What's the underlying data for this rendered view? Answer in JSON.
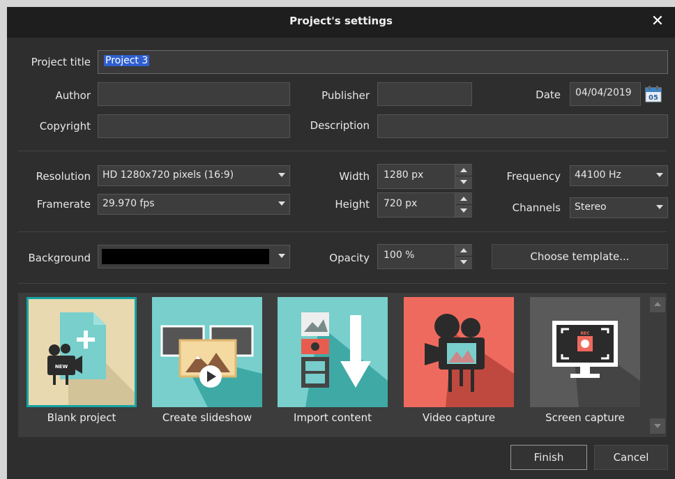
{
  "dialog": {
    "title": "Project's settings",
    "close_glyph": "✕"
  },
  "fields": {
    "project_title_label": "Project title",
    "project_title_value": "Project 3",
    "author_label": "Author",
    "author_value": "",
    "publisher_label": "Publisher",
    "publisher_value": "",
    "date_label": "Date",
    "date_value": "04/04/2019",
    "date_icon_day": "05",
    "copyright_label": "Copyright",
    "copyright_value": "",
    "description_label": "Description",
    "description_value": ""
  },
  "video": {
    "resolution_label": "Resolution",
    "resolution_value": "HD 1280x720 pixels (16:9)",
    "framerate_label": "Framerate",
    "framerate_value": "29.970 fps",
    "width_label": "Width",
    "width_value": "1280 px",
    "height_label": "Height",
    "height_value": "720 px",
    "frequency_label": "Frequency",
    "frequency_value": "44100 Hz",
    "channels_label": "Channels",
    "channels_value": "Stereo"
  },
  "background": {
    "background_label": "Background",
    "background_color": "#000000",
    "opacity_label": "Opacity",
    "opacity_value": "100 %",
    "choose_template_label": "Choose template..."
  },
  "templates": [
    {
      "label": "Blank project",
      "icon": "blank-project-icon",
      "bg": "#e9d9b0",
      "selected": true
    },
    {
      "label": "Create slideshow",
      "icon": "slideshow-icon",
      "bg": "#78cfcc",
      "selected": false
    },
    {
      "label": "Import content",
      "icon": "import-content-icon",
      "bg": "#78cfcc",
      "selected": false
    },
    {
      "label": "Video capture",
      "icon": "video-capture-icon",
      "bg": "#ef6a5e",
      "selected": false
    },
    {
      "label": "Screen capture",
      "icon": "screen-capture-icon",
      "bg": "#5a5a5a",
      "selected": false
    }
  ],
  "footer": {
    "finish_label": "Finish",
    "cancel_label": "Cancel"
  },
  "colors": {
    "accent_selection": "#2f5fd0",
    "tile_outline": "#15a4a4"
  }
}
